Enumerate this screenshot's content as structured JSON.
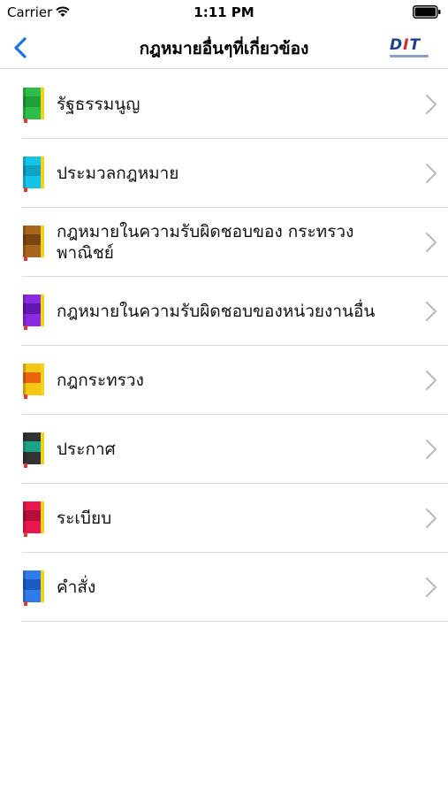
{
  "status": {
    "carrier": "Carrier",
    "time": "1:11 PM"
  },
  "nav": {
    "title": "กฎหมายอื่นๆที่เกี่ยวข้อง",
    "back_icon": "chevron-left-icon",
    "logo_text": "DIT"
  },
  "colors": {
    "accent": "#1a73e8",
    "separator": "#dadada",
    "chevron": "#b8b8c0"
  },
  "items": [
    {
      "label": "รัฐธรรมนูญ",
      "icon": "book-icon",
      "color": "#2ebd4a",
      "band": "#1f9e39"
    },
    {
      "label": "ประมวลกฎหมาย",
      "icon": "book-icon",
      "color": "#15c3e8",
      "band": "#0ea3c6"
    },
    {
      "label": "กฎหมายในความรับผิดชอบของ กระทรวงพาณิชย์",
      "icon": "book-icon",
      "color": "#a8651e",
      "band": "#7a4510"
    },
    {
      "label": "กฎหมายในความรับผิดชอบของหน่วยงานอื่น",
      "icon": "book-icon",
      "color": "#8a2be2",
      "band": "#6417b0"
    },
    {
      "label": "กฎกระทรวง",
      "icon": "book-icon",
      "color": "#f5c517",
      "band": "#e8640f"
    },
    {
      "label": "ประกาศ",
      "icon": "book-icon",
      "color": "#333333",
      "band": "#1aa58a"
    },
    {
      "label": "ระเบียบ",
      "icon": "book-icon",
      "color": "#e8174e",
      "band": "#b30f3a"
    },
    {
      "label": "คำสั่ง",
      "icon": "book-icon",
      "color": "#2f7be8",
      "band": "#1a5cc4"
    }
  ]
}
